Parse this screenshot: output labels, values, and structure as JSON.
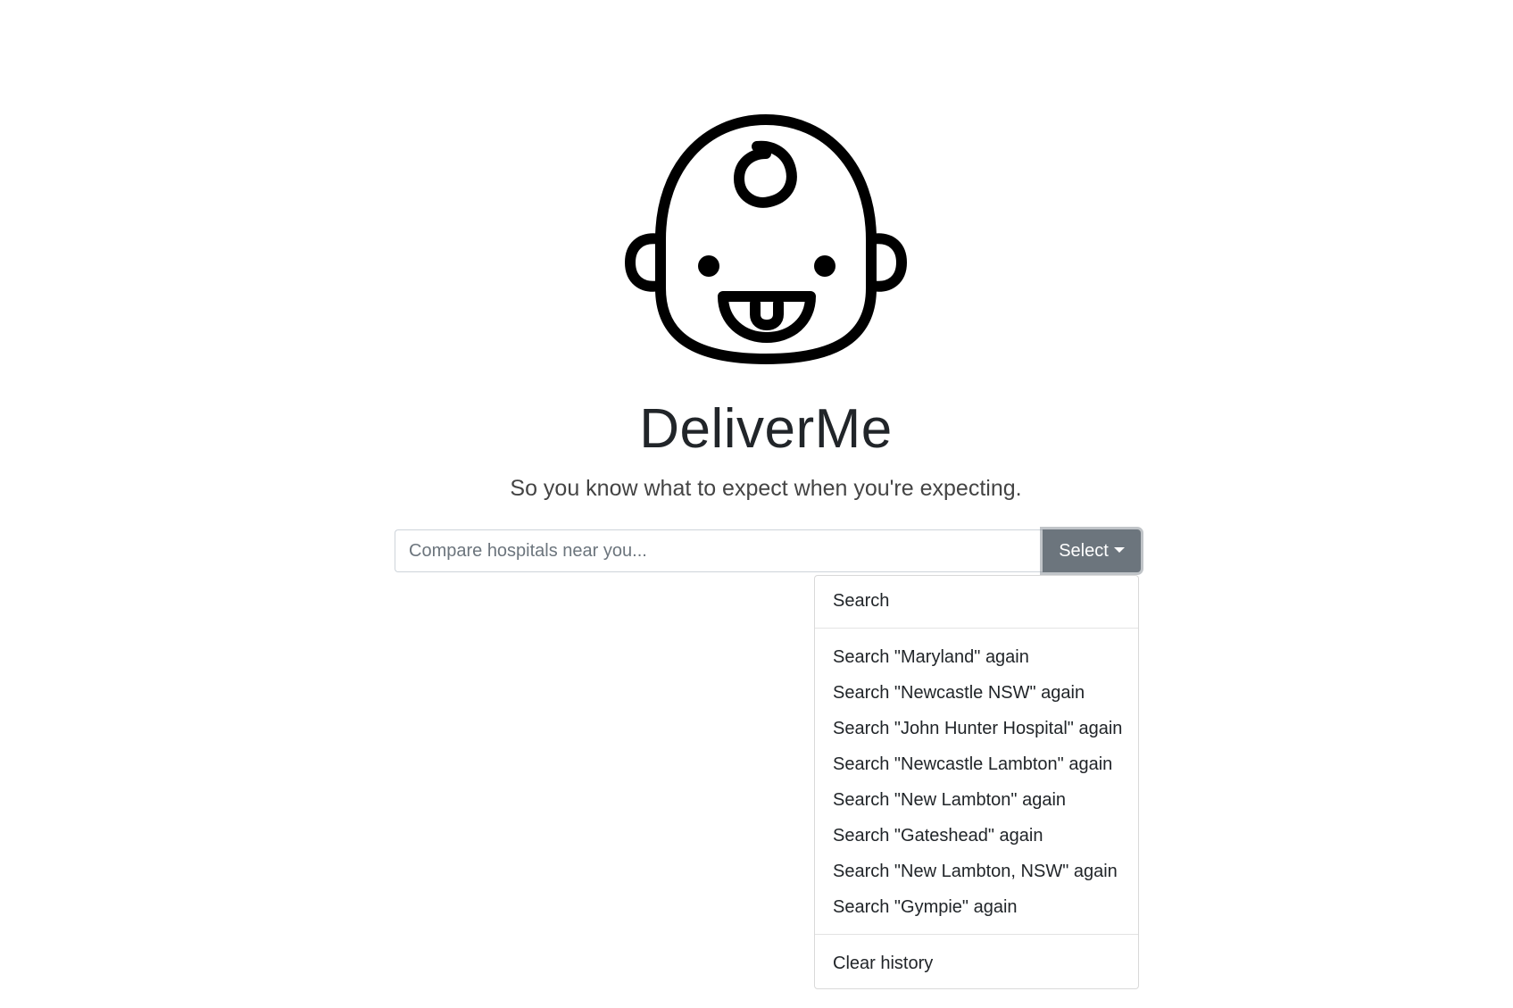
{
  "app": {
    "title": "DeliverMe",
    "tagline": "So you know what to expect when you're expecting."
  },
  "logo": {
    "icon": "baby-face-icon"
  },
  "search": {
    "placeholder": "Compare hospitals near you...",
    "value": "",
    "button_label": "Select"
  },
  "dropdown": {
    "top_item": "Search",
    "history": [
      "Search \"Maryland\" again",
      "Search \"Newcastle NSW\" again",
      "Search \"John Hunter Hospital\" again",
      "Search \"Newcastle Lambton\" again",
      "Search \"New Lambton\" again",
      "Search \"Gateshead\" again",
      "Search \"New Lambton, NSW\" again",
      "Search \"Gympie\" again"
    ],
    "clear_label": "Clear history"
  },
  "colors": {
    "button_bg": "#6c757d",
    "text": "#212529",
    "border": "#ced4da"
  }
}
